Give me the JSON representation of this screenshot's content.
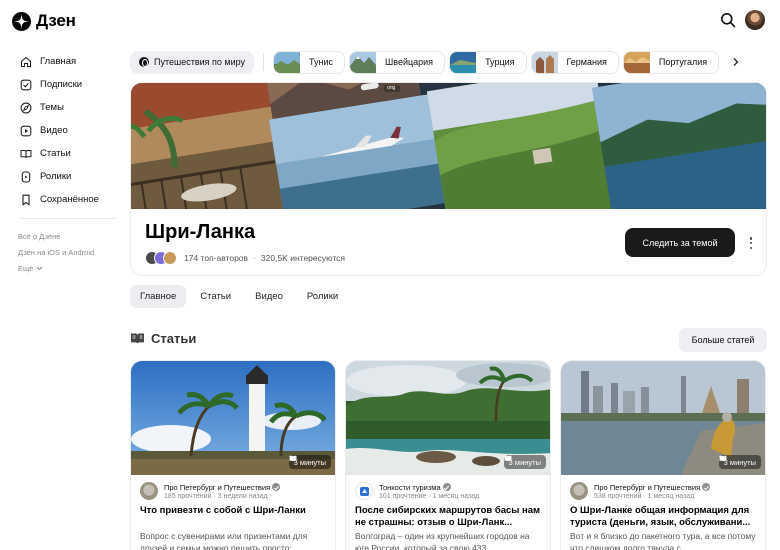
{
  "header": {
    "logo_text": "Дзен"
  },
  "sidebar": {
    "items": [
      {
        "label": "Главная",
        "icon": "home-icon"
      },
      {
        "label": "Подписки",
        "icon": "subscriptions-icon"
      },
      {
        "label": "Темы",
        "icon": "compass-icon"
      },
      {
        "label": "Видео",
        "icon": "video-icon"
      },
      {
        "label": "Статьи",
        "icon": "book-icon"
      },
      {
        "label": "Ролики",
        "icon": "shorts-icon"
      },
      {
        "label": "Сохранённое",
        "icon": "bookmark-icon"
      }
    ],
    "footer": {
      "about": "Всё о Дзене",
      "apps": "Дзен на iOS и Android",
      "more": "Ещё"
    }
  },
  "topics": {
    "active": "Путешествия по миру",
    "items": [
      "Тунис",
      "Швейцария",
      "Турция",
      "Германия",
      "Португалия"
    ]
  },
  "hero": {
    "image_caption": "orig",
    "title": "Шри-Ланка",
    "authors": "174 топ-авторов",
    "interested": "320,5K интересуются",
    "follow_label": "Следить за темой"
  },
  "tabs": [
    "Главное",
    "Статьи",
    "Видео",
    "Ролики"
  ],
  "section": {
    "title": "Статьи",
    "more_label": "Больше статей"
  },
  "cards": [
    {
      "read_time": "3 минуты",
      "author": "Про Петербург и Путешествия",
      "meta": "185 прочтений · 3 недели назад",
      "title": "Что привезти с собой с Шри-Ланки",
      "text": "Вопрос с сувенирами или призентами для друзей и семьи можно решить просто: магнитики и мелкие поделки из"
    },
    {
      "read_time": "3 минуты",
      "author": "Тонкости туризма",
      "meta": "101 прочтение · 1 месяц назад",
      "title": "После сибирских маршрутов басы нам не страшны: отзыв о Шри-Ланк...",
      "text": "Волгоград – один из крупнейших городов на юге России, который за свою 433"
    },
    {
      "read_time": "3 минуты",
      "author": "Про Петербург и Путешествия",
      "meta": "538 прочтений · 1 месяц назад",
      "title": "О Шри-Ланке общая информация для туриста (деньги, язык, обслуживани...",
      "text": "Вот и я близко до пакетного тура, а все потому что слишком долго тянула с"
    }
  ]
}
